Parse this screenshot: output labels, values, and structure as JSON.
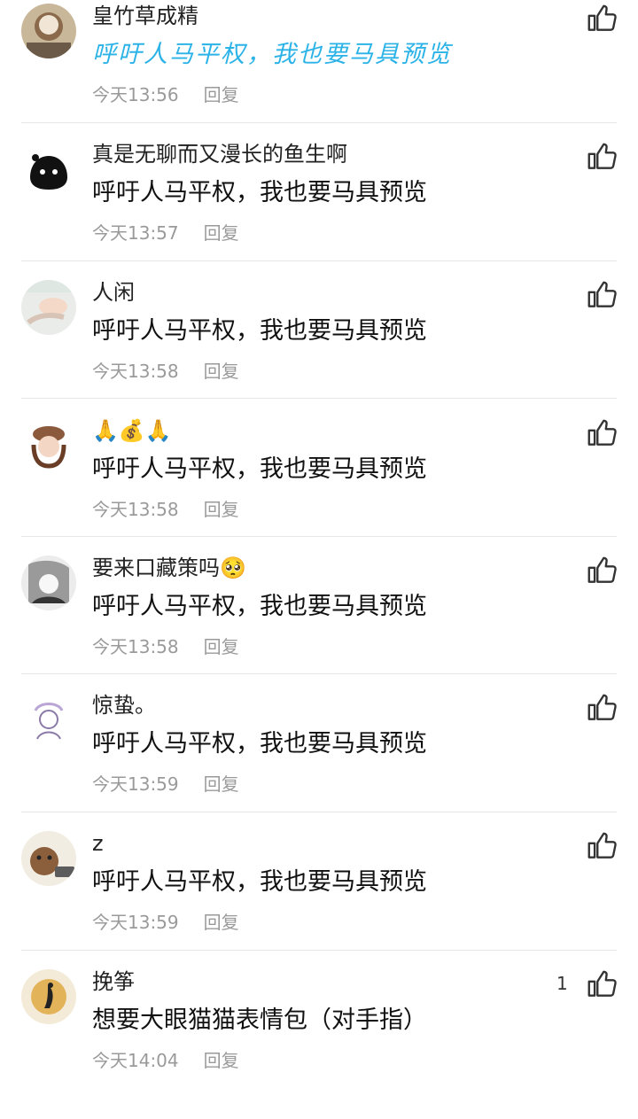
{
  "comments": [
    {
      "username": "皇竹草成精",
      "text": "呼吁人马平权，我也要马具预览",
      "time": "今天13:56",
      "reply": "回复",
      "likes": ""
    },
    {
      "username": "真是无聊而又漫长的鱼生啊",
      "text": "呼吁人马平权，我也要马具预览",
      "time": "今天13:57",
      "reply": "回复",
      "likes": ""
    },
    {
      "username": "人闲",
      "text": "呼吁人马平权，我也要马具预览",
      "time": "今天13:58",
      "reply": "回复",
      "likes": ""
    },
    {
      "username": "🙏💰🙏",
      "text": "呼吁人马平权，我也要马具预览",
      "time": "今天13:58",
      "reply": "回复",
      "likes": ""
    },
    {
      "username": "要来口藏策吗🥺",
      "text": "呼吁人马平权，我也要马具预览",
      "time": "今天13:58",
      "reply": "回复",
      "likes": ""
    },
    {
      "username": "惊蛰。",
      "text": "呼吁人马平权，我也要马具预览",
      "time": "今天13:59",
      "reply": "回复",
      "likes": ""
    },
    {
      "username": "z",
      "text": "呼吁人马平权，我也要马具预览",
      "time": "今天13:59",
      "reply": "回复",
      "likes": ""
    },
    {
      "username": "挽筝",
      "text": "想要大眼猫猫表情包（对手指）",
      "time": "今天14:04",
      "reply": "回复",
      "likes": "1"
    }
  ],
  "icons": {
    "like": "thumbs-up-icon"
  },
  "colors": {
    "accent_text": "#2bb3e8",
    "meta": "#9a9a9a",
    "divider": "#e6e6e6"
  }
}
